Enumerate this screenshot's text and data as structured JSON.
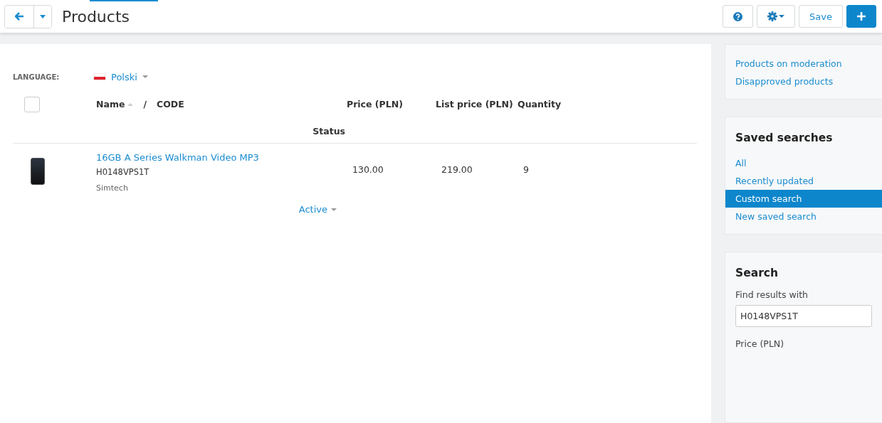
{
  "header": {
    "title": "Products",
    "nav": [
      {
        "kind": "back"
      },
      {
        "kind": "caret"
      }
    ],
    "buttons": [
      {
        "kind": "help"
      },
      {
        "kind": "gear"
      },
      {
        "kind": "text",
        "label": "Save"
      },
      {
        "kind": "add"
      }
    ]
  },
  "language": {
    "label": "LANGUAGE:",
    "value": "Polski"
  },
  "table": {
    "select_all": {
      "checked": false
    },
    "name_column": {
      "label": "Name",
      "sorted": true,
      "separator": "/",
      "code_label": "CODE"
    },
    "columns": [
      "Price (PLN)",
      "List price (PLN)",
      "Quantity",
      "Status"
    ],
    "rows": [
      {
        "name": "16GB A Series Walkman Video MP3",
        "code": "H0148VPS1T",
        "vendor": "Simtech",
        "price": "130.00",
        "list_price": "219.00",
        "quantity": "9",
        "status": "Active"
      }
    ]
  },
  "sidebar": {
    "links": [
      "Products on moderation",
      "Disapproved products"
    ],
    "saved_searches": {
      "title": "Saved searches",
      "items": [
        {
          "label": "All",
          "selected": false
        },
        {
          "label": "Recently updated",
          "selected": false
        },
        {
          "label": "Custom search",
          "selected": true
        },
        {
          "label": "New saved search",
          "selected": false
        }
      ]
    },
    "search": {
      "title": "Search",
      "find_label": "Find results with",
      "value": "H0148VPS1T",
      "price_label": "Price (PLN)"
    }
  }
}
